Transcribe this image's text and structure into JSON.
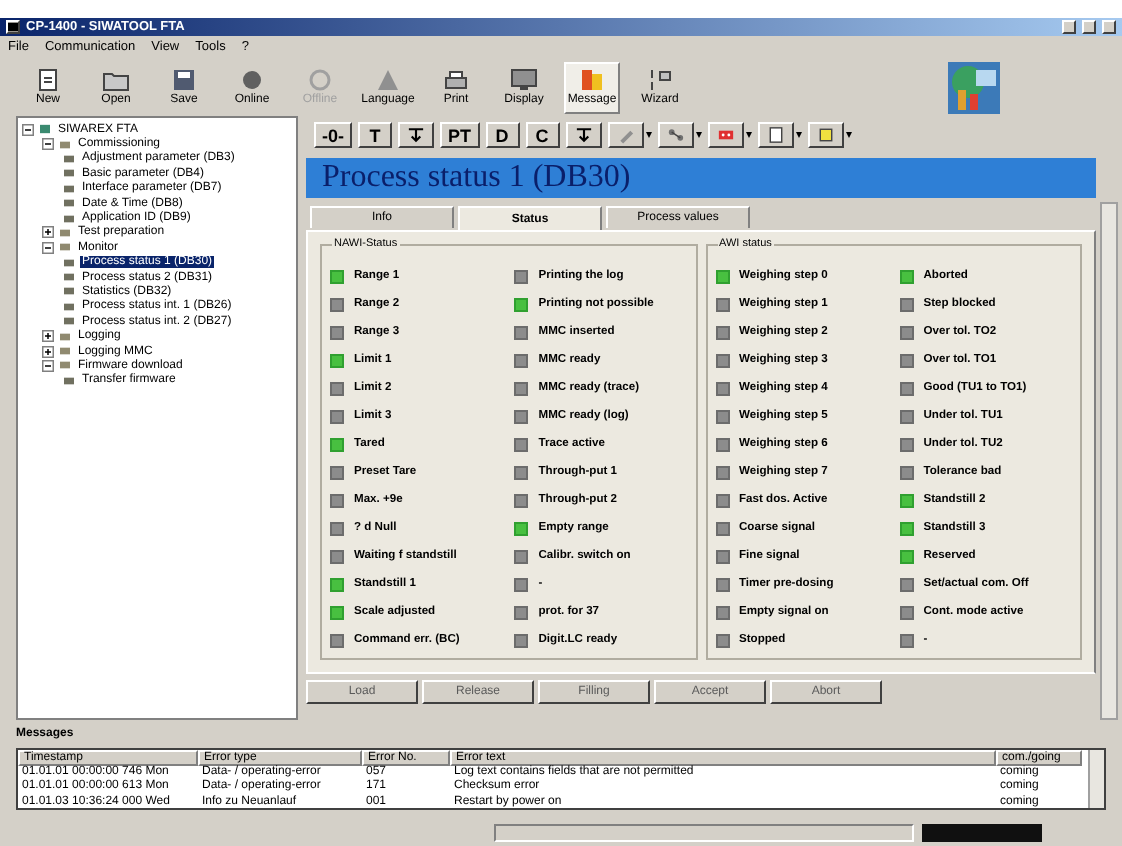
{
  "window": {
    "title": "CP-1400 - SIWATOOL FTA"
  },
  "menu": [
    "File",
    "Communication",
    "View",
    "Tools",
    "?"
  ],
  "toolbar": [
    {
      "label": "New",
      "disabled": false,
      "selected": false
    },
    {
      "label": "Open",
      "disabled": false,
      "selected": false
    },
    {
      "label": "Save",
      "disabled": false,
      "selected": false
    },
    {
      "label": "Online",
      "disabled": false,
      "selected": false
    },
    {
      "label": "Offline",
      "disabled": true,
      "selected": false
    },
    {
      "label": "Language",
      "disabled": false,
      "selected": false
    },
    {
      "label": "Print",
      "disabled": false,
      "selected": false
    },
    {
      "label": "Display",
      "disabled": false,
      "selected": false
    },
    {
      "label": "Message",
      "disabled": false,
      "selected": true
    },
    {
      "label": "Wizard",
      "disabled": false,
      "selected": false
    }
  ],
  "tree": [
    {
      "label": "SIWAREX FTA",
      "kind": "root",
      "expanded": true,
      "selected": false,
      "children": [
        {
          "label": "Commissioning",
          "kind": "folder",
          "expanded": true,
          "selected": false,
          "children": [
            {
              "label": "Adjustment parameter (DB3)",
              "kind": "leaf",
              "selected": false
            },
            {
              "label": "Basic parameter (DB4)",
              "kind": "leaf",
              "selected": false
            },
            {
              "label": "Interface parameter (DB7)",
              "kind": "leaf",
              "selected": false
            },
            {
              "label": "Date & Time (DB8)",
              "kind": "leaf",
              "selected": false
            },
            {
              "label": "Application ID (DB9)",
              "kind": "leaf",
              "selected": false
            }
          ]
        },
        {
          "label": "Test preparation",
          "kind": "folder",
          "expanded": false,
          "selected": false
        },
        {
          "label": "Monitor",
          "kind": "folder",
          "expanded": true,
          "selected": false,
          "children": [
            {
              "label": "Process status 1 (DB30)",
              "kind": "leaf",
              "selected": true
            },
            {
              "label": "Process status 2 (DB31)",
              "kind": "leaf",
              "selected": false
            },
            {
              "label": "Statistics (DB32)",
              "kind": "leaf",
              "selected": false
            },
            {
              "label": "Process status int. 1 (DB26)",
              "kind": "leaf",
              "selected": false
            },
            {
              "label": "Process status int. 2 (DB27)",
              "kind": "leaf",
              "selected": false
            }
          ]
        },
        {
          "label": "Logging",
          "kind": "folder",
          "expanded": false,
          "selected": false
        },
        {
          "label": "Logging MMC",
          "kind": "folder",
          "expanded": false,
          "selected": false
        },
        {
          "label": "Firmware download",
          "kind": "folder",
          "expanded": true,
          "selected": false,
          "children": [
            {
              "label": "Transfer firmware",
              "kind": "leaf",
              "selected": false
            }
          ]
        }
      ]
    }
  ],
  "command_buttons": [
    {
      "kind": "text",
      "label": "-0-"
    },
    {
      "kind": "text",
      "label": "T"
    },
    {
      "kind": "icon"
    },
    {
      "kind": "text",
      "label": "PT"
    },
    {
      "kind": "text",
      "label": "D"
    },
    {
      "kind": "text",
      "label": "C"
    },
    {
      "kind": "icon"
    },
    {
      "kind": "dropdown"
    },
    {
      "kind": "dropdown"
    },
    {
      "kind": "dropdown"
    },
    {
      "kind": "dropdown"
    },
    {
      "kind": "dropdown"
    }
  ],
  "panel": {
    "title": "Process status 1 (DB30)",
    "tabs": [
      {
        "label": "Info",
        "selected": false
      },
      {
        "label": "Status",
        "selected": true
      },
      {
        "label": "Process values",
        "selected": false
      }
    ],
    "groups": [
      {
        "title": "NAWI-Status",
        "columns": [
          [
            {
              "label": "Range 1",
              "on": true
            },
            {
              "label": "Range 2",
              "on": false
            },
            {
              "label": "Range 3",
              "on": false
            },
            {
              "label": "Limit 1",
              "on": true
            },
            {
              "label": "Limit 2",
              "on": false
            },
            {
              "label": "Limit 3",
              "on": false
            },
            {
              "label": "Tared",
              "on": true
            },
            {
              "label": "Preset Tare",
              "on": false
            },
            {
              "label": "Max. +9e",
              "on": false
            },
            {
              "label": "? d Null",
              "on": false
            },
            {
              "label": "Waiting f standstill",
              "on": false
            },
            {
              "label": "Standstill 1",
              "on": true
            },
            {
              "label": "Scale adjusted",
              "on": true
            },
            {
              "label": "Command err. (BC)",
              "on": false
            }
          ],
          [
            {
              "label": "Printing the log",
              "on": false
            },
            {
              "label": "Printing not possible",
              "on": true
            },
            {
              "label": "MMC inserted",
              "on": false
            },
            {
              "label": "MMC ready",
              "on": false
            },
            {
              "label": "MMC ready (trace)",
              "on": false
            },
            {
              "label": "MMC ready (log)",
              "on": false
            },
            {
              "label": "Trace active",
              "on": false
            },
            {
              "label": "Through-put 1",
              "on": false
            },
            {
              "label": "Through-put 2",
              "on": false
            },
            {
              "label": "Empty range",
              "on": true
            },
            {
              "label": "Calibr. switch on",
              "on": false
            },
            {
              "label": "-",
              "on": false
            },
            {
              "label": "prot. for 37",
              "on": false
            },
            {
              "label": "Digit.LC ready",
              "on": false
            }
          ]
        ]
      },
      {
        "title": "AWI status",
        "columns": [
          [
            {
              "label": "Weighing step 0",
              "on": true
            },
            {
              "label": "Weighing step 1",
              "on": false
            },
            {
              "label": "Weighing step 2",
              "on": false
            },
            {
              "label": "Weighing step 3",
              "on": false
            },
            {
              "label": "Weighing step 4",
              "on": false
            },
            {
              "label": "Weighing step 5",
              "on": false
            },
            {
              "label": "Weighing step 6",
              "on": false
            },
            {
              "label": "Weighing step 7",
              "on": false
            },
            {
              "label": "Fast dos. Active",
              "on": false
            },
            {
              "label": "Coarse signal",
              "on": false
            },
            {
              "label": "Fine signal",
              "on": false
            },
            {
              "label": "Timer pre-dosing",
              "on": false
            },
            {
              "label": "Empty signal on",
              "on": false
            },
            {
              "label": "Stopped",
              "on": false
            }
          ],
          [
            {
              "label": "Aborted",
              "on": true
            },
            {
              "label": "Step blocked",
              "on": false
            },
            {
              "label": "Over tol. TO2",
              "on": false
            },
            {
              "label": "Over tol. TO1",
              "on": false
            },
            {
              "label": "Good (TU1 to TO1)",
              "on": false
            },
            {
              "label": "Under tol. TU1",
              "on": false
            },
            {
              "label": "Under tol. TU2",
              "on": false
            },
            {
              "label": "Tolerance bad",
              "on": false
            },
            {
              "label": "Standstill 2",
              "on": true
            },
            {
              "label": "Standstill 3",
              "on": true
            },
            {
              "label": "Reserved",
              "on": true
            },
            {
              "label": "Set/actual com. Off",
              "on": false
            },
            {
              "label": "Cont. mode active",
              "on": false
            },
            {
              "label": "-",
              "on": false
            }
          ]
        ]
      }
    ],
    "buttons": [
      {
        "label": "Load",
        "disabled": true
      },
      {
        "label": "Release",
        "disabled": true
      },
      {
        "label": "Filling",
        "disabled": true
      },
      {
        "label": "Accept",
        "disabled": true
      },
      {
        "label": "Abort",
        "disabled": true
      }
    ]
  },
  "messages": {
    "title": "Messages",
    "columns": [
      "Timestamp",
      "Error type",
      "Error No.",
      "Error text",
      "com./going"
    ],
    "rows": [
      [
        "01.01.01 00:00:00 746 Mon",
        "Data- / operating-error",
        "057",
        "Log text contains fields that are not permitted",
        "coming"
      ],
      [
        "01.01.01 00:00:00 613 Mon",
        "Data- / operating-error",
        "171",
        "Checksum error",
        "coming"
      ],
      [
        "01.01.03 10:36:24 000 Wed",
        "Info zu Neuanlauf",
        "001",
        "Restart by power on",
        "coming"
      ]
    ]
  }
}
